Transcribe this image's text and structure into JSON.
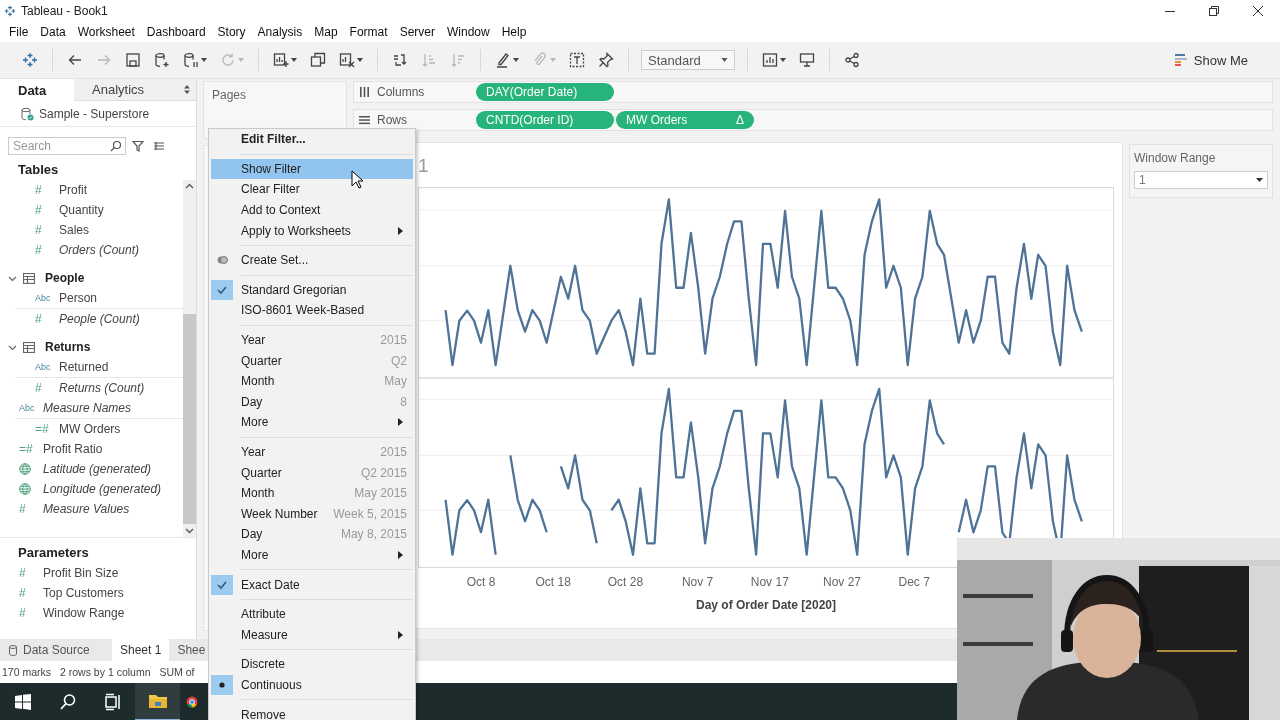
{
  "window": {
    "title": "Tableau - Book1"
  },
  "menu_bar": [
    "File",
    "Data",
    "Worksheet",
    "Dashboard",
    "Story",
    "Analysis",
    "Map",
    "Format",
    "Server",
    "Window",
    "Help"
  ],
  "toolbar": {
    "groups": [
      [
        {
          "kind": "back-arrow",
          "disabled": false,
          "menu": false
        },
        {
          "kind": "forward-arrow",
          "disabled": true,
          "menu": false
        },
        {
          "kind": "save",
          "disabled": false,
          "menu": false
        },
        {
          "kind": "database-plus",
          "disabled": false,
          "menu": false
        },
        {
          "kind": "database-pause",
          "disabled": false,
          "menu": true
        },
        {
          "kind": "refresh",
          "disabled": true,
          "menu": true
        }
      ],
      [
        {
          "kind": "chart-plus",
          "disabled": false,
          "menu": true
        },
        {
          "kind": "duplicate",
          "disabled": false,
          "menu": false
        },
        {
          "kind": "chart-clear",
          "disabled": false,
          "menu": true
        }
      ],
      [
        {
          "kind": "swap",
          "disabled": false,
          "menu": false
        },
        {
          "kind": "sort-ascending",
          "disabled": true,
          "menu": false
        },
        {
          "kind": "sort-descending",
          "disabled": true,
          "menu": false
        }
      ],
      [
        {
          "kind": "highlighter",
          "disabled": false,
          "menu": true
        },
        {
          "kind": "paperclip",
          "disabled": true,
          "menu": true
        },
        {
          "kind": "text-label",
          "disabled": false,
          "menu": false
        },
        {
          "kind": "pin",
          "disabled": false,
          "menu": false
        }
      ]
    ],
    "fit": "Standard",
    "after": [
      {
        "kind": "cards",
        "disabled": false,
        "menu": true
      },
      {
        "kind": "presentation",
        "disabled": false,
        "menu": false
      }
    ],
    "share": {
      "kind": "share",
      "disabled": false,
      "menu": false
    },
    "show_me": "Show Me"
  },
  "data_pane": {
    "tabs": [
      {
        "label": "Data",
        "selected": true
      },
      {
        "label": "Analytics",
        "selected": false
      }
    ],
    "data_source": "Sample - Superstore",
    "search": {
      "placeholder": "Search"
    },
    "tables_title": "Tables",
    "table_items": [
      {
        "kind": "measure",
        "label": "Profit",
        "badge": "#",
        "italic": false
      },
      {
        "kind": "measure",
        "label": "Quantity",
        "badge": "#",
        "italic": false
      },
      {
        "kind": "measure",
        "label": "Sales",
        "badge": "#",
        "italic": false
      },
      {
        "kind": "measure",
        "label": "Orders (Count)",
        "badge": "#",
        "italic": true
      },
      {
        "kind": "group",
        "label": "People",
        "expanded": true,
        "children": [
          {
            "kind": "dimension",
            "label": "Person",
            "badge": "Abc",
            "italic": false
          },
          {
            "kind": "measure",
            "label": "People (Count)",
            "badge": "#",
            "italic": true
          }
        ]
      },
      {
        "kind": "group",
        "label": "Returns",
        "expanded": true,
        "children": [
          {
            "kind": "dimension",
            "label": "Returned",
            "badge": "Abc",
            "italic": false
          },
          {
            "kind": "measure",
            "label": "Returns (Count)",
            "badge": "#",
            "italic": true
          }
        ]
      }
    ],
    "fields": [
      {
        "kind": "dimension",
        "label": "Measure Names",
        "badge": "Abc",
        "italic": true
      },
      {
        "kind": "calc",
        "label": "MW Orders",
        "badge": "=#",
        "italic": false
      },
      {
        "kind": "calc",
        "label": "Profit Ratio",
        "badge": "=#",
        "italic": false
      },
      {
        "kind": "geo",
        "label": "Latitude (generated)",
        "italic": true
      },
      {
        "kind": "geo",
        "label": "Longitude (generated)",
        "italic": true
      },
      {
        "kind": "measure",
        "label": "Measure Values",
        "badge": "#",
        "italic": true
      }
    ],
    "parameters_title": "Parameters",
    "parameters": [
      {
        "label": "Profit Bin Size",
        "badge": "#"
      },
      {
        "label": "Top Customers",
        "badge": "#"
      },
      {
        "label": "Window Range",
        "badge": "#"
      }
    ]
  },
  "pages": {
    "title": "Pages"
  },
  "shelves": [
    {
      "kind": "columns",
      "label": "Columns",
      "pills": [
        {
          "label": "DAY(Order Date)"
        }
      ]
    },
    {
      "kind": "rows",
      "label": "Rows",
      "pills": [
        {
          "label": "CNTD(Order ID)"
        },
        {
          "label": "MW Orders",
          "delta": "Δ"
        }
      ]
    }
  ],
  "view": {
    "title": "1",
    "x_labels": [
      "Oct 8",
      "Oct 18",
      "Oct 28",
      "Nov 7",
      "Nov 17",
      "Nov 27",
      "Dec 7"
    ],
    "axis_title": "Day of Order Date [2020]"
  },
  "parameter_card": {
    "title": "Window Range",
    "value": "1"
  },
  "sheet_tabs": [
    {
      "kind": "data-source",
      "label": "Data Source",
      "selected": false
    },
    {
      "kind": "sheet",
      "label": "Sheet 1",
      "selected": true
    },
    {
      "kind": "sheet",
      "label": "Shee",
      "selected": false
    }
  ],
  "status_bar": [
    "170 marks",
    "2 rows by 1 column",
    "SUM of"
  ],
  "context_menu": {
    "sections": [
      {
        "items": [
          {
            "label": "Edit Filter...",
            "kind": "default",
            "highlighted": false
          }
        ]
      },
      {
        "items": [
          {
            "label": "Show Filter",
            "kind": "command",
            "highlighted": true
          },
          {
            "label": "Clear Filter",
            "kind": "command",
            "highlighted": false
          },
          {
            "label": "Add to Context",
            "kind": "command",
            "highlighted": false
          },
          {
            "label": "Apply to Worksheets",
            "kind": "submenu",
            "highlighted": false
          }
        ]
      },
      {
        "items": [
          {
            "label": "Create Set...",
            "kind": "set",
            "highlighted": false
          }
        ]
      },
      {
        "items": [
          {
            "label": "Standard Gregorian",
            "kind": "check",
            "checked": true,
            "highlighted": false
          },
          {
            "label": "ISO-8601 Week-Based",
            "kind": "check",
            "checked": false,
            "highlighted": false
          }
        ]
      },
      {
        "items": [
          {
            "label": "Year",
            "hint": "2015",
            "kind": "command",
            "highlighted": false
          },
          {
            "label": "Quarter",
            "hint": "Q2",
            "kind": "command",
            "highlighted": false
          },
          {
            "label": "Month",
            "hint": "May",
            "kind": "command",
            "highlighted": false
          },
          {
            "label": "Day",
            "hint": "8",
            "kind": "command",
            "highlighted": false
          },
          {
            "label": "More",
            "kind": "submenu",
            "highlighted": false
          }
        ]
      },
      {
        "items": [
          {
            "label": "Year",
            "hint": "2015",
            "kind": "command",
            "highlighted": false
          },
          {
            "label": "Quarter",
            "hint": "Q2 2015",
            "kind": "command",
            "highlighted": false
          },
          {
            "label": "Month",
            "hint": "May 2015",
            "kind": "command",
            "highlighted": false
          },
          {
            "label": "Week Number",
            "hint": "Week 5, 2015",
            "kind": "command",
            "highlighted": false
          },
          {
            "label": "Day",
            "hint": "May 8, 2015",
            "kind": "command",
            "highlighted": false
          },
          {
            "label": "More",
            "kind": "submenu",
            "highlighted": false
          }
        ]
      },
      {
        "items": [
          {
            "label": "Exact Date",
            "kind": "check",
            "checked": true,
            "highlighted": false
          }
        ]
      },
      {
        "items": [
          {
            "label": "Attribute",
            "kind": "command",
            "highlighted": false
          },
          {
            "label": "Measure",
            "kind": "submenu",
            "highlighted": false
          }
        ]
      },
      {
        "items": [
          {
            "label": "Discrete",
            "kind": "radio",
            "checked": false,
            "highlighted": false
          },
          {
            "label": "Continuous",
            "kind": "radio",
            "checked": true,
            "highlighted": false
          }
        ]
      },
      {
        "items": [
          {
            "label": "Remove",
            "kind": "command",
            "highlighted": false
          }
        ]
      }
    ]
  },
  "webcam": {
    "kind": "picture"
  }
}
